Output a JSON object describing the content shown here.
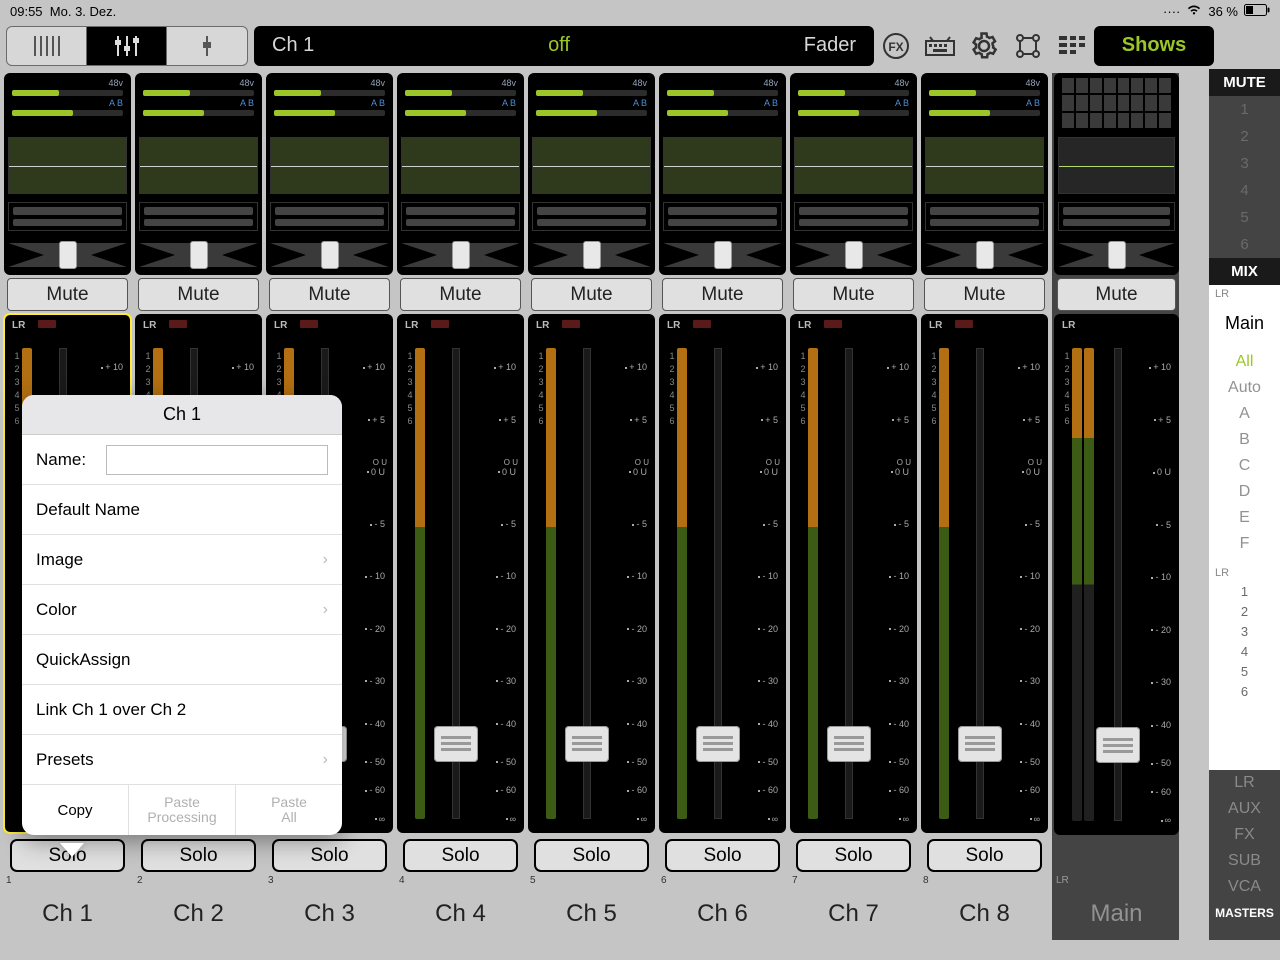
{
  "statusbar": {
    "time": "09:55",
    "date": "Mo. 3. Dez.",
    "battery": "36 %"
  },
  "toolbar": {
    "lcd_left": "Ch 1",
    "lcd_mid": "off",
    "lcd_right": "Fader",
    "shows": "Shows"
  },
  "channels": [
    {
      "num": "1",
      "label": "Ch 1",
      "mute": "Mute",
      "solo": "Solo",
      "lr": "LR",
      "v48": "48v",
      "ab": "A B"
    },
    {
      "num": "2",
      "label": "Ch 2",
      "mute": "Mute",
      "solo": "Solo",
      "lr": "LR",
      "v48": "48v",
      "ab": "A B"
    },
    {
      "num": "3",
      "label": "Ch 3",
      "mute": "Mute",
      "solo": "Solo",
      "lr": "LR",
      "v48": "48v",
      "ab": "A B"
    },
    {
      "num": "4",
      "label": "Ch 4",
      "mute": "Mute",
      "solo": "Solo",
      "lr": "LR",
      "v48": "48v",
      "ab": "A B"
    },
    {
      "num": "5",
      "label": "Ch 5",
      "mute": "Mute",
      "solo": "Solo",
      "lr": "LR",
      "v48": "48v",
      "ab": "A B"
    },
    {
      "num": "6",
      "label": "Ch 6",
      "mute": "Mute",
      "solo": "Solo",
      "lr": "LR",
      "v48": "48v",
      "ab": "A B"
    },
    {
      "num": "7",
      "label": "Ch 7",
      "mute": "Mute",
      "solo": "Solo",
      "lr": "LR",
      "v48": "48v",
      "ab": "A B"
    },
    {
      "num": "8",
      "label": "Ch 8",
      "mute": "Mute",
      "solo": "Solo",
      "lr": "LR",
      "v48": "48v",
      "ab": "A B"
    }
  ],
  "master": {
    "label": "Main",
    "mute": "Mute",
    "lr": "LR",
    "num": "LR"
  },
  "scale": [
    "+ 10",
    "+ 5",
    "0 U",
    "- 5",
    "- 10",
    "- 20",
    "- 30",
    "- 40",
    "- 50",
    "- 60",
    "∞"
  ],
  "sidebar": {
    "mute_hdr": "MUTE",
    "mute_nums": [
      "1",
      "2",
      "3",
      "4",
      "5",
      "6"
    ],
    "mix_hdr": "MIX",
    "lr": "LR",
    "main": "Main",
    "groups": [
      "All",
      "Auto",
      "A",
      "B",
      "C",
      "D",
      "E",
      "F"
    ],
    "masters": [
      "LR",
      "AUX",
      "FX",
      "SUB",
      "VCA"
    ],
    "masters_hdr": "MASTERS"
  },
  "popup": {
    "title": "Ch 1",
    "name_label": "Name:",
    "name_value": "",
    "default_name": "Default Name",
    "image": "Image",
    "color": "Color",
    "quickassign": "QuickAssign",
    "link": "Link Ch 1 over Ch 2",
    "presets": "Presets",
    "copy": "Copy",
    "paste_proc": "Paste Processing",
    "paste_all": "Paste All"
  }
}
